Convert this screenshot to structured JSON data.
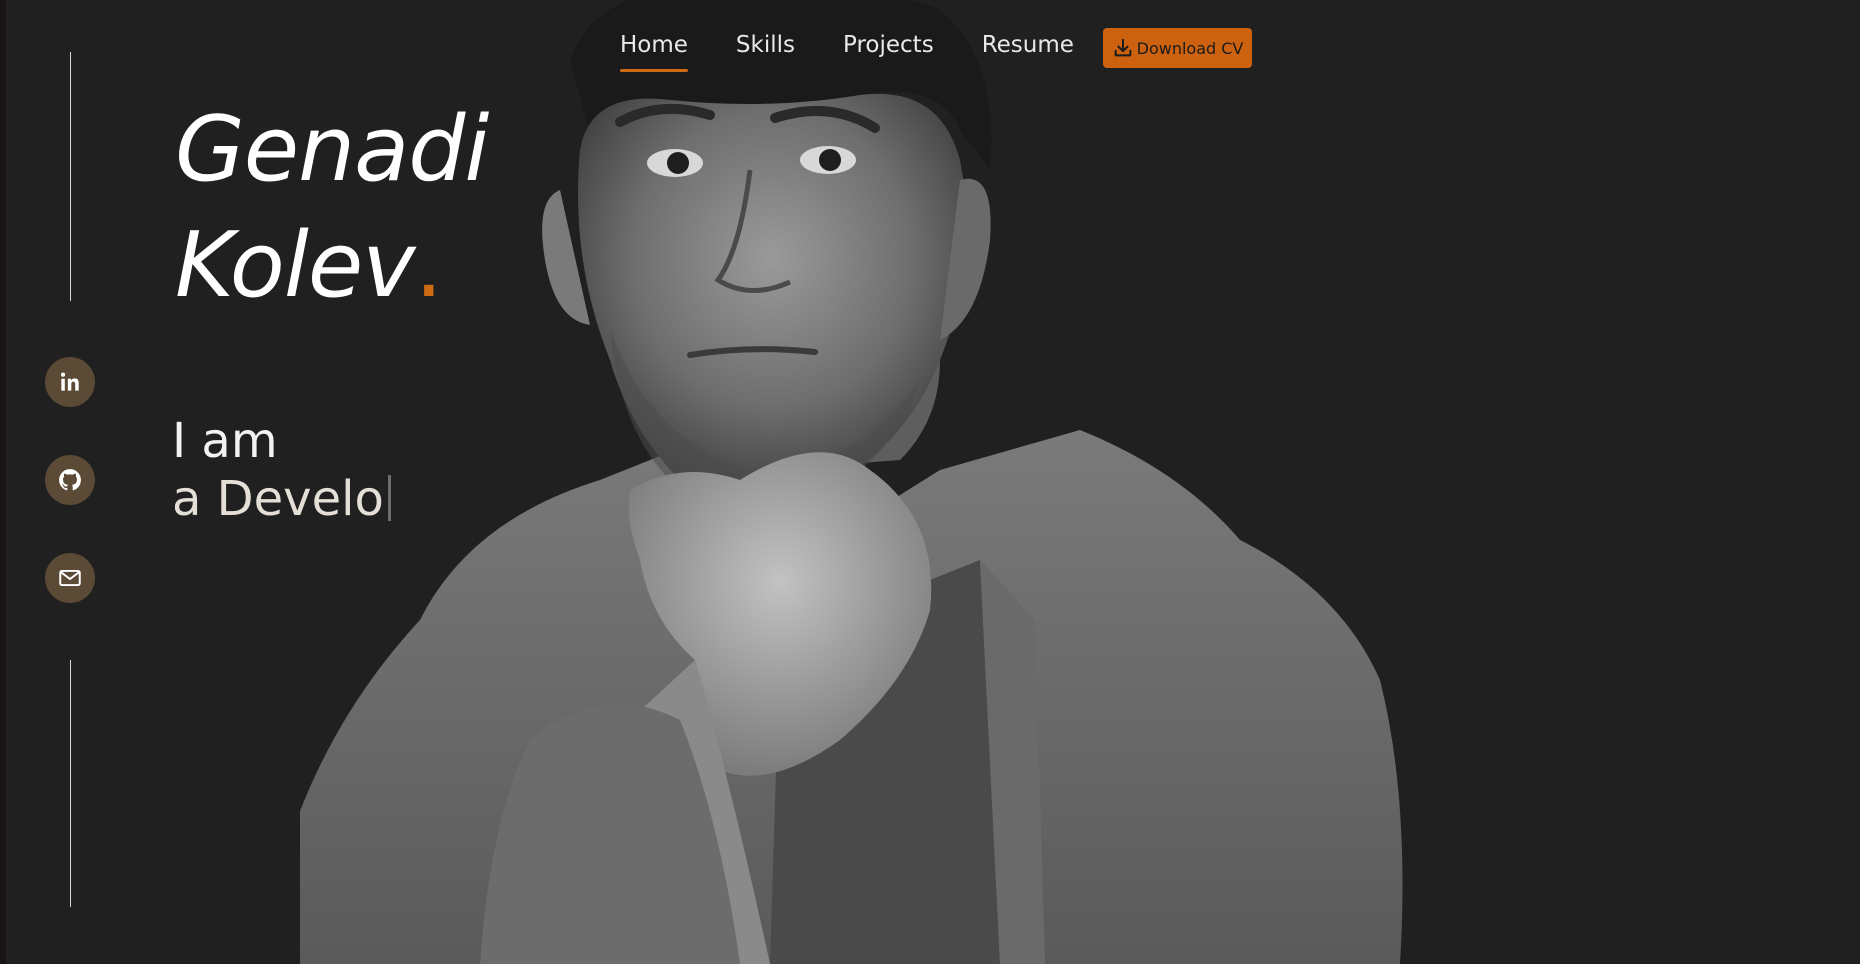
{
  "nav": {
    "items": [
      {
        "label": "Home",
        "active": true
      },
      {
        "label": "Skills",
        "active": false
      },
      {
        "label": "Projects",
        "active": false
      },
      {
        "label": "Resume",
        "active": false
      }
    ],
    "download_label": "Download CV"
  },
  "hero": {
    "first_name": "Genadi",
    "last_name": "Kolev",
    "dot": ".",
    "intro_line1": "I am",
    "intro_line2": "a Develo"
  },
  "social": [
    {
      "icon": "linkedin-icon"
    },
    {
      "icon": "github-icon"
    },
    {
      "icon": "mail-icon"
    }
  ],
  "colors": {
    "background": "#202020",
    "accent": "#cd6b14",
    "social_bg": "#5b4a36",
    "text": "#ffffff"
  }
}
